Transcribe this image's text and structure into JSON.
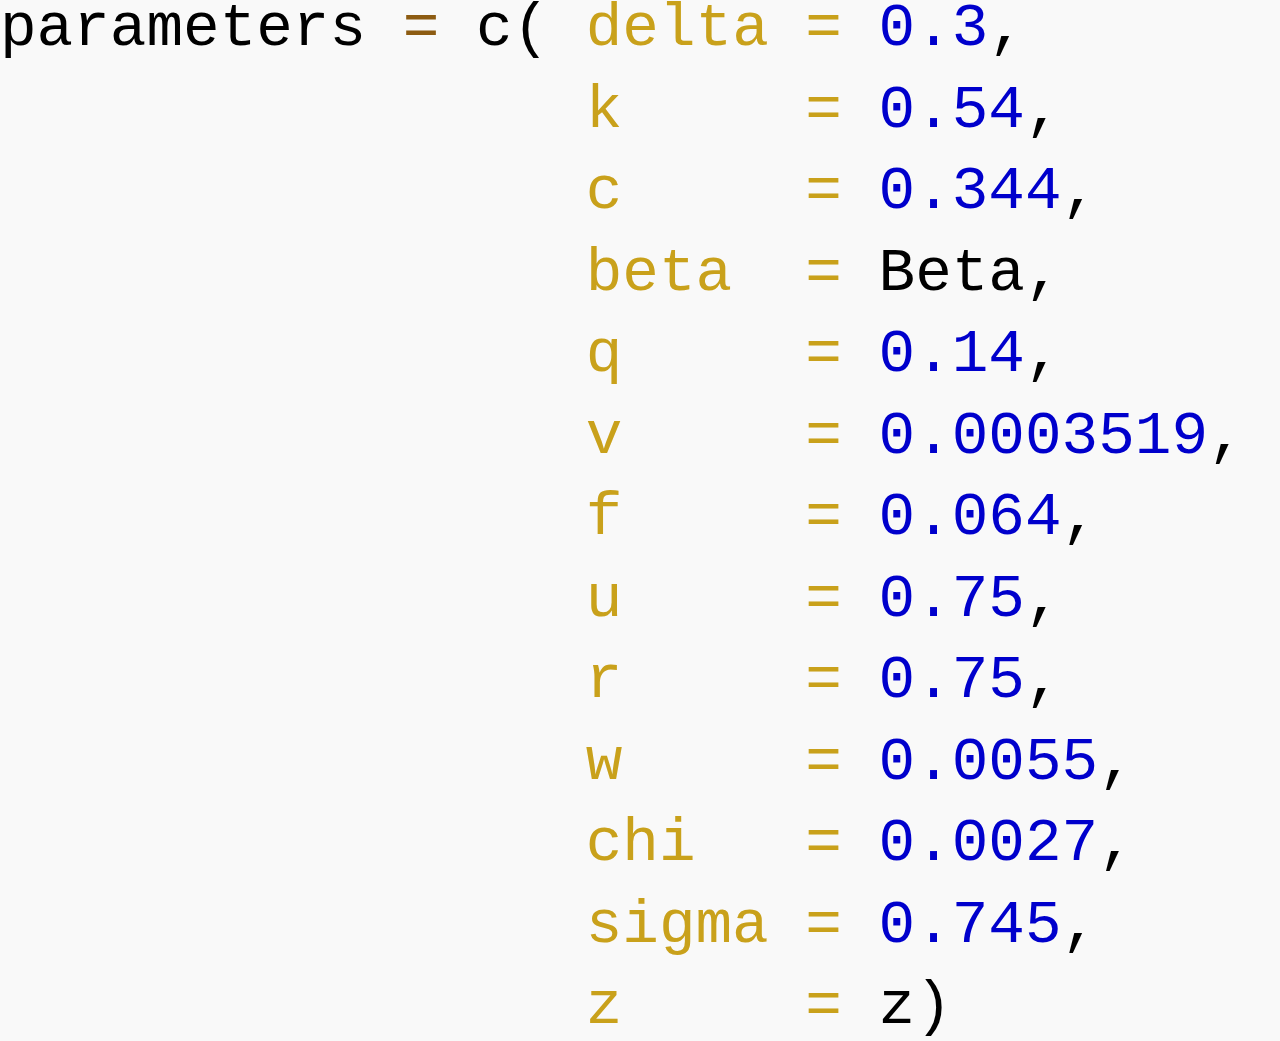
{
  "code": {
    "target": "parameters",
    "operator": "=",
    "call_open": "c(",
    "entries": [
      {
        "name": "delta",
        "value": "0.3",
        "kind": "number",
        "punct": ","
      },
      {
        "name": "k",
        "value": "0.54",
        "kind": "number",
        "punct": ","
      },
      {
        "name": "c",
        "value": "0.344",
        "kind": "number",
        "punct": ","
      },
      {
        "name": "beta",
        "value": "Beta",
        "kind": "identifier",
        "punct": ","
      },
      {
        "name": "q",
        "value": "0.14",
        "kind": "number",
        "punct": ","
      },
      {
        "name": "v",
        "value": "0.0003519",
        "kind": "number",
        "punct": ","
      },
      {
        "name": "f",
        "value": "0.064",
        "kind": "number",
        "punct": ","
      },
      {
        "name": "u",
        "value": "0.75",
        "kind": "number",
        "punct": ","
      },
      {
        "name": "r",
        "value": "0.75",
        "kind": "number",
        "punct": ","
      },
      {
        "name": "w",
        "value": "0.0055",
        "kind": "number",
        "punct": ","
      },
      {
        "name": "chi",
        "value": "0.0027",
        "kind": "number",
        "punct": ","
      },
      {
        "name": "sigma",
        "value": "0.745",
        "kind": "number",
        "punct": ","
      },
      {
        "name": "z",
        "value": "z",
        "kind": "identifier",
        "punct": ")"
      }
    ]
  }
}
